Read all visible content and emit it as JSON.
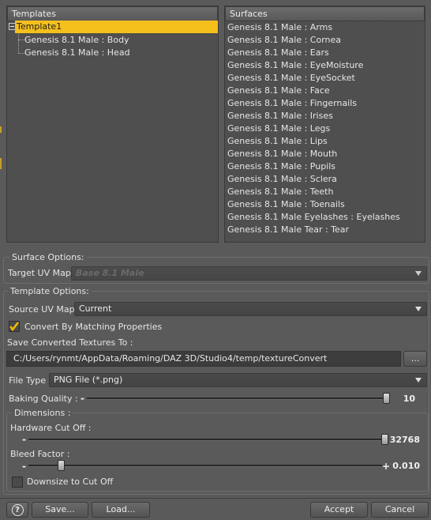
{
  "templates": {
    "header": "Templates",
    "root": "Template1",
    "children": [
      "Genesis 8.1 Male : Body",
      "Genesis 8.1 Male : Head"
    ]
  },
  "surfaces": {
    "header": "Surfaces",
    "items": [
      "Genesis 8.1 Male : Arms",
      "Genesis 8.1 Male : Cornea",
      "Genesis 8.1 Male : Ears",
      "Genesis 8.1 Male : EyeMoisture",
      "Genesis 8.1 Male : EyeSocket",
      "Genesis 8.1 Male : Face",
      "Genesis 8.1 Male : Fingernails",
      "Genesis 8.1 Male : Irises",
      "Genesis 8.1 Male : Legs",
      "Genesis 8.1 Male : Lips",
      "Genesis 8.1 Male : Mouth",
      "Genesis 8.1 Male : Pupils",
      "Genesis 8.1 Male : Sclera",
      "Genesis 8.1 Male : Teeth",
      "Genesis 8.1 Male : Toenails",
      "Genesis 8.1 Male Eyelashes : Eyelashes",
      "Genesis 8.1 Male Tear : Tear"
    ]
  },
  "surface_options": {
    "title": "Surface Options:",
    "target_uv_label": "Target UV Map :",
    "target_uv_value": "Base 8.1 Male"
  },
  "template_options": {
    "title": "Template Options:",
    "source_uv_label": "Source UV Map :",
    "source_uv_value": "Current",
    "convert_label": "Convert By Matching Properties",
    "convert_checked": true,
    "save_to_label": "Save Converted Textures To :",
    "save_path": "C:/Users/rynmt/AppData/Roaming/DAZ 3D/Studio4/temp/textureConvert",
    "browse_label": "...",
    "file_type_label": "File Type :",
    "file_type_value": "PNG File (*.png)",
    "baking_quality_label": "Baking Quality :",
    "baking_quality_value": "10",
    "baking_quality_fraction": 1.0
  },
  "dimensions": {
    "title": "Dimensions :",
    "hardware_cutoff_label": "Hardware Cut Off :",
    "hardware_cutoff_value": "32768",
    "hardware_cutoff_fraction": 1.0,
    "bleed_label": "Bleed Factor :",
    "bleed_value": "0.010",
    "bleed_fraction": 0.1,
    "downsize_label": "Downsize to Cut Off",
    "downsize_checked": false,
    "minus": "-",
    "plus": "+"
  },
  "footer": {
    "help_icon": "?",
    "save": "Save...",
    "load": "Load...",
    "accept": "Accept",
    "cancel": "Cancel"
  },
  "colors": {
    "selection": "#f5c01c",
    "checkbox": "#f5b800"
  }
}
